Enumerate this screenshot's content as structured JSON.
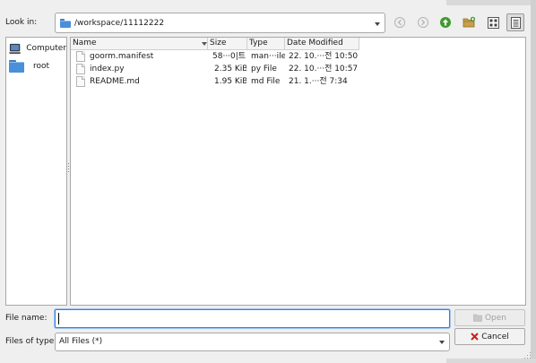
{
  "look_in": {
    "label": "Look in:",
    "path": "/workspace/11112222"
  },
  "toolbar": {
    "buttons": [
      {
        "name": "back",
        "icon": "back-arrow-icon",
        "enabled": false
      },
      {
        "name": "forward",
        "icon": "forward-arrow-icon",
        "enabled": false
      },
      {
        "name": "parent",
        "icon": "up-arrow-icon",
        "enabled": true
      },
      {
        "name": "new_folder",
        "icon": "new-folder-icon",
        "enabled": true
      },
      {
        "name": "list_view",
        "icon": "list-view-icon",
        "enabled": true
      },
      {
        "name": "detail_view",
        "icon": "detail-view-icon",
        "enabled": true,
        "pressed": true
      }
    ]
  },
  "sidebar": {
    "items": [
      {
        "label": "Computer",
        "icon": "computer-icon"
      },
      {
        "label": "root",
        "icon": "folder-icon"
      }
    ]
  },
  "file_list": {
    "columns": [
      "Name",
      "Size",
      "Type",
      "Date Modified"
    ],
    "rows": [
      {
        "name": "goorm.manifest",
        "size": "58···0|트",
        "type": "man···ile",
        "date": "22. 10.···전 10:50"
      },
      {
        "name": "index.py",
        "size": "2.35 KiB",
        "type": "py File",
        "date": "22. 10.···전 10:57"
      },
      {
        "name": "README.md",
        "size": "1.95 KiB",
        "type": "md File",
        "date": "21. 1.···전 7:34"
      }
    ]
  },
  "file_name": {
    "label": "File name:",
    "value": ""
  },
  "file_type": {
    "label": "Files of type:",
    "value": "All Files (*)"
  },
  "buttons": {
    "open": "Open",
    "cancel": "Cancel"
  },
  "colors": {
    "folder": "#4a8fd8",
    "focus_border": "#3a7fd1",
    "up_arrow": "#3c9a2c",
    "cancel_x": "#c8201a"
  }
}
